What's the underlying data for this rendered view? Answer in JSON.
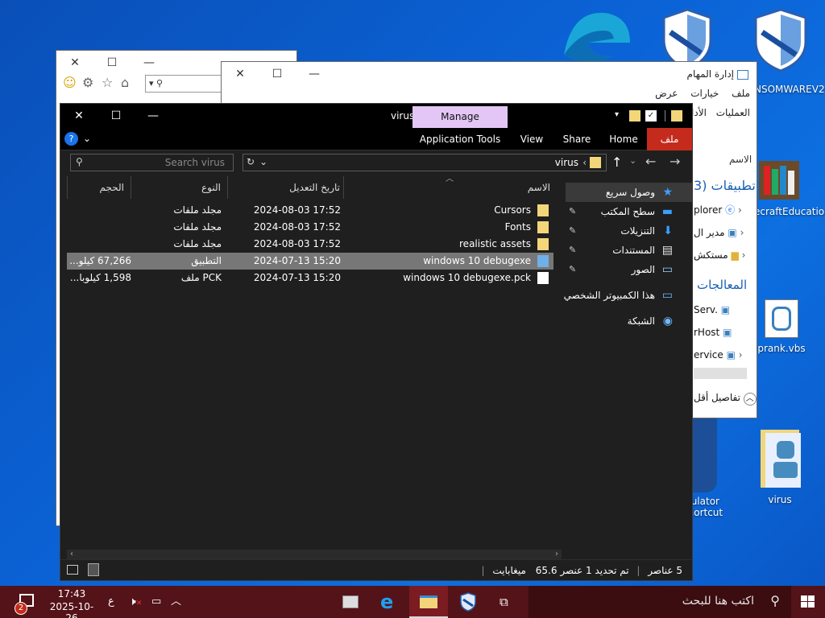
{
  "desktop": {
    "icons": [
      {
        "label": "NSOMWAREV2"
      },
      {
        "label": "ecraftEducatio..."
      },
      {
        "label": "prank.vbs"
      },
      {
        "label": "mulator\nShortcut"
      },
      {
        "label": "virus"
      }
    ]
  },
  "taskmanager": {
    "title": "إدارة المهام",
    "menu": [
      "ملف",
      "خيارات",
      "عرض"
    ],
    "tabs": [
      "العمليات",
      "الأدا"
    ],
    "col_name": "الاسم",
    "section_apps": "تطبيقات (3",
    "section_bg": "المعالجات",
    "items": [
      "plorer",
      "مدير ال",
      "مستكش",
      "Serv.",
      "rHost",
      "ervice"
    ],
    "details": "تفاصيل أقل"
  },
  "explorer": {
    "title": "virus",
    "ribbon": {
      "file_tab": "ملف",
      "tabs": [
        "Home",
        "Share",
        "View"
      ],
      "manage": "Manage",
      "app_tools": "Application Tools"
    },
    "nav": {
      "path": "virus",
      "search_placeholder": "Search virus"
    },
    "columns": {
      "name": "الاسم",
      "date": "تاريخ التعديل",
      "type": "النوع",
      "size": "الحجم"
    },
    "files": [
      {
        "name": "Cursors",
        "date": "2024-08-03 17:52",
        "type": "مجلد ملفات",
        "size": "",
        "icon": "folder-icon"
      },
      {
        "name": "Fonts",
        "date": "2024-08-03 17:52",
        "type": "مجلد ملفات",
        "size": "",
        "icon": "fonts-folder-icon"
      },
      {
        "name": "realistic assets",
        "date": "2024-08-03 17:52",
        "type": "مجلد ملفات",
        "size": "",
        "icon": "folder-icon"
      },
      {
        "name": "windows 10 debugexe",
        "date": "2024-07-13 15:20",
        "type": "التطبيق",
        "size": "67,266 كيلو...",
        "icon": "application-icon",
        "selected": true
      },
      {
        "name": "windows 10 debugexe.pck",
        "date": "2024-07-13 15:20",
        "type": "ملف PCK",
        "size": "1,598 كيلوبا...",
        "icon": "file-icon"
      }
    ],
    "pane": [
      {
        "label": "وصول سريع",
        "icon": "quick-access-icon"
      },
      {
        "label": "سطح المكتب",
        "icon": "desktop-icon"
      },
      {
        "label": "التنزيلات",
        "icon": "downloads-icon"
      },
      {
        "label": "المستندات",
        "icon": "documents-icon"
      },
      {
        "label": "الصور",
        "icon": "pictures-icon"
      },
      {
        "label": "هذا الكمبيوتر الشخصي",
        "icon": "this-pc-icon"
      },
      {
        "label": "الشبكة",
        "icon": "network-icon"
      }
    ],
    "status": {
      "count": "5 عناصر",
      "selection": "تم تحديد 1 عنصر",
      "size": "65.6 ميغابايت"
    }
  },
  "taskbar": {
    "search_placeholder": "اكتب هنا للبحث",
    "time": "17:43",
    "date": "2025-10-26",
    "lang": "ع",
    "notif_count": "2"
  },
  "colors": {
    "file_tab": "#c42b1c",
    "manage_tab": "#e3c6f5",
    "taskbar": "#541318",
    "selection": "#777777"
  }
}
